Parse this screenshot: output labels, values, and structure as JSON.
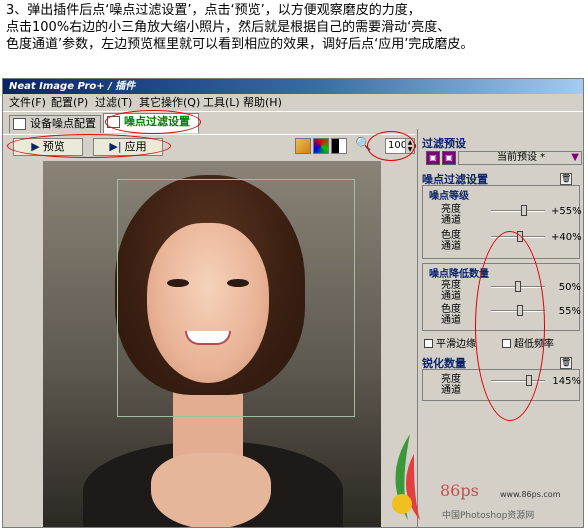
{
  "intro": {
    "line1": "3、弹出插件后点‘噪点过滤设置’，点击‘预览’，以方便观察磨皮的力度，",
    "line2": "点击100%右边的小三角放大缩小照片，然后就是根据自己的需要滑动‘亮度、",
    "line3": "色度通道’参数，左边预览框里就可以看到相应的效果，调好后点‘应用’完成磨皮。"
  },
  "window": {
    "title": "Neat Image Pro+ / 插件"
  },
  "menu": [
    "文件(F)",
    "配置(P)",
    "过滤(T)",
    "其它操作(Q)",
    "工具(L)",
    "帮助(H)"
  ],
  "tabs": [
    {
      "label": "设备噪点配置"
    },
    {
      "label": "噪点过滤设置"
    }
  ],
  "toolbar": {
    "preview_label": "预览",
    "apply_label": "应用",
    "zoom": "100%"
  },
  "panel": {
    "preset_title": "过滤预设",
    "preset_value": "当前预设 *",
    "filter_title": "噪点过滤设置",
    "noise_level_title": "噪点等级",
    "luma_label": "亮度通道",
    "chroma_label": "色度通道",
    "noise_level_luma_value": "+55%",
    "noise_level_luma_pos": 0.62,
    "noise_level_chroma_value": "+40%",
    "noise_level_chroma_pos": 0.55,
    "reduce_title": "噪点降低数量",
    "reduce_luma_value": "50%",
    "reduce_luma_pos": 0.5,
    "reduce_chroma_value": "55%",
    "reduce_chroma_pos": 0.55,
    "smooth_edges": "平滑边缘",
    "ultra_low": "超低频率",
    "sharpen_title": "锐化数量",
    "sharpen_luma_value": "145%",
    "sharpen_luma_pos": 0.72
  },
  "watermark": {
    "brand": "86ps",
    "url": "www.86ps.com",
    "caption": "中国Photoshop资源网"
  },
  "colors": {
    "title_bar": "#0a246a",
    "highlight": "#e00000",
    "tab_active": "#008000"
  }
}
